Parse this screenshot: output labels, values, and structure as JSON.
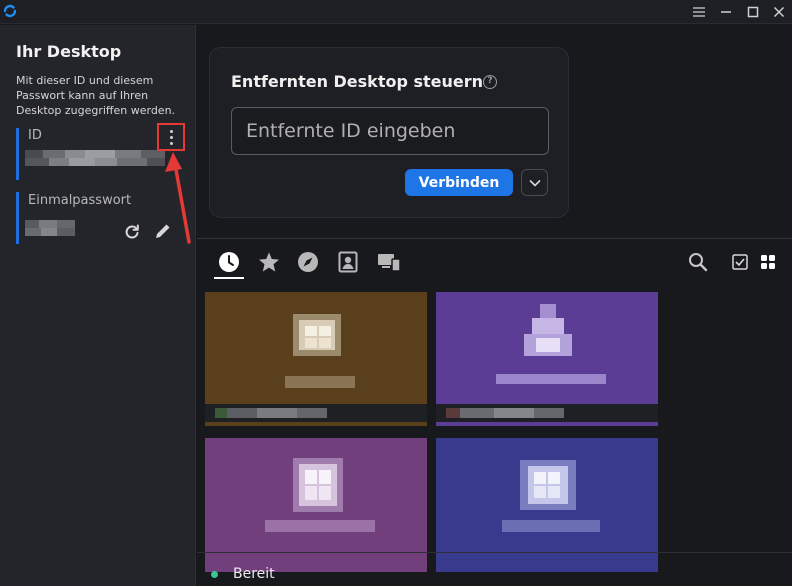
{
  "sidebar": {
    "title": "Ihr Desktop",
    "description": "Mit dieser ID und diesem Passwort kann auf Ihren Desktop zugegriffen werden.",
    "id_label": "ID",
    "password_label": "Einmalpasswort"
  },
  "main": {
    "card_title": "Entfernten Desktop steuern",
    "input_placeholder": "Entfernte ID eingeben",
    "connect_label": "Verbinden"
  },
  "tabs": [
    {
      "icon": "recent-clock-icon",
      "active": true
    },
    {
      "icon": "favorites-star-icon",
      "active": false
    },
    {
      "icon": "discovered-compass-icon",
      "active": false
    },
    {
      "icon": "address-book-icon",
      "active": false
    },
    {
      "icon": "devices-icon",
      "active": false
    }
  ],
  "peers": [
    {
      "color": "#5a3f1c"
    },
    {
      "color": "#5c3d96"
    },
    {
      "color": "#703f7c"
    },
    {
      "color": "#383a8e"
    }
  ],
  "status": {
    "text": "Bereit",
    "color": "#3ec28f"
  },
  "colors": {
    "accent": "#1e76e6",
    "highlight": "#e53935"
  }
}
